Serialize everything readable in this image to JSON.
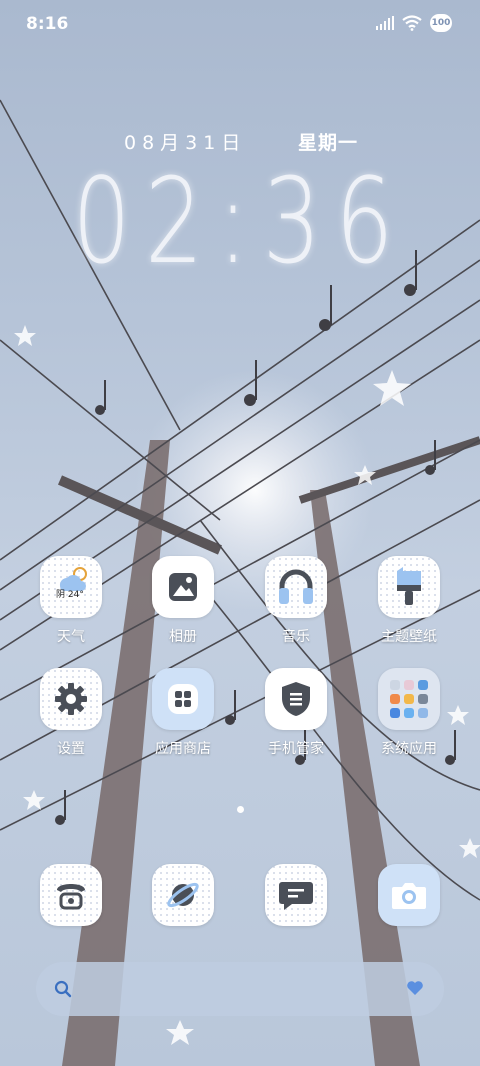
{
  "status_bar": {
    "time": "8:16",
    "battery": "100"
  },
  "lockscreen": {
    "date": "08月31日",
    "weekday": "星期一",
    "clock": "02:36"
  },
  "apps": [
    {
      "label": "天气",
      "icon": "weather-icon",
      "widget_text": "阴 24°"
    },
    {
      "label": "相册",
      "icon": "gallery-icon"
    },
    {
      "label": "音乐",
      "icon": "headphones-icon"
    },
    {
      "label": "主题壁纸",
      "icon": "theme-brush-icon"
    },
    {
      "label": "设置",
      "icon": "gear-icon"
    },
    {
      "label": "应用商店",
      "icon": "app-store-icon"
    },
    {
      "label": "手机管家",
      "icon": "shield-icon"
    },
    {
      "label": "系统应用",
      "icon": "folder-icon"
    }
  ],
  "dock": [
    {
      "icon": "phone-icon"
    },
    {
      "icon": "browser-planet-icon"
    },
    {
      "icon": "message-icon"
    },
    {
      "icon": "camera-icon"
    }
  ],
  "search_bar": {
    "left_icon": "search-icon",
    "right_icon": "heart-icon"
  },
  "colors": {
    "accent": "#cfe1f7",
    "icon_dark": "#4a4f58"
  }
}
